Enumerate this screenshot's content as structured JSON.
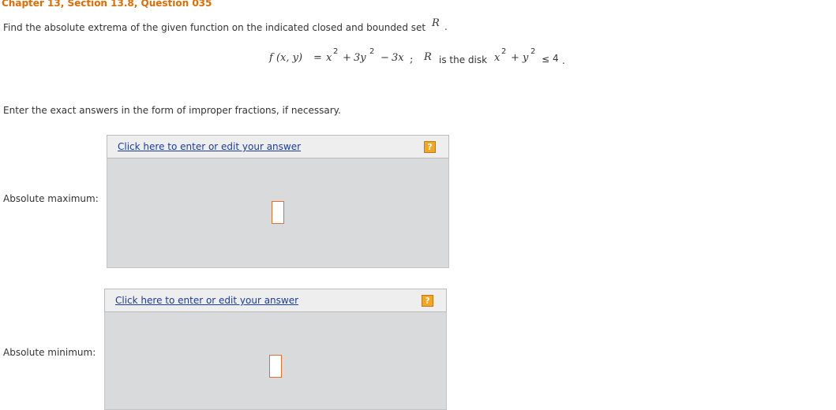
{
  "header": {
    "title": "Chapter 13, Section 13.8, Question 035"
  },
  "question": {
    "prompt": "Find the absolute extrema of the given function on the indicated closed and bounded set",
    "set_symbol": "R",
    "prompt_end": ".",
    "equation": {
      "lhs": "f (x, y)",
      "eq": "=",
      "t1": "x",
      "t1_exp": "2",
      "plus1": "+",
      "t2": "3y",
      "t2_exp": "2",
      "minus": "−",
      "t3": "3x",
      "semicolon": ";",
      "region": "R",
      "region_text": "is the disk",
      "d1": "x",
      "d1_exp": "2",
      "plus2": "+",
      "d2": "y",
      "d2_exp": "2",
      "le": "≤",
      "bound": "4",
      "end": "."
    },
    "instructions": "Enter the exact answers in the form of improper fractions, if necessary."
  },
  "answers": [
    {
      "label": "Absolute maximum:",
      "link_text": "Click here to enter or edit your answer",
      "help_icon": "?",
      "value": ""
    },
    {
      "label": "Absolute minimum:",
      "link_text": "Click here to enter or edit your answer",
      "help_icon": "?",
      "value": ""
    }
  ],
  "colors": {
    "title": "#e06b00",
    "link": "#1a3c9e",
    "help": "#f5a623",
    "panel_header": "#eeeeee",
    "panel_body": "#d9dadc",
    "input_border": "#e07030"
  }
}
